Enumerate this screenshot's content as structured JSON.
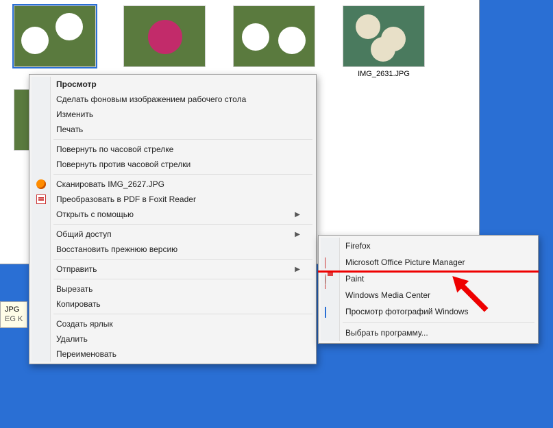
{
  "thumbs": {
    "t1": {
      "label": ""
    },
    "t2": {
      "label": ""
    },
    "t3": {
      "label": ""
    },
    "t4": {
      "label": "IMG_2631.JPG"
    }
  },
  "tooltip": {
    "line1": "JPG",
    "line2": "EG   K"
  },
  "context_menu": {
    "view": "Просмотр",
    "set_wallpaper": "Сделать фоновым изображением рабочего стола",
    "edit": "Изменить",
    "print": "Печать",
    "rotate_cw": "Повернуть по часовой стрелке",
    "rotate_ccw": "Повернуть против часовой стрелки",
    "scan": "Сканировать IMG_2627.JPG",
    "to_pdf": "Преобразовать в PDF в Foxit Reader",
    "open_with": "Открыть с помощью",
    "share": "Общий доступ",
    "restore": "Восстановить прежнюю версию",
    "send_to": "Отправить",
    "cut": "Вырезать",
    "copy": "Копировать",
    "shortcut": "Создать ярлык",
    "delete": "Удалить",
    "rename": "Переименовать"
  },
  "submenu": {
    "firefox": "Firefox",
    "mspic": "Microsoft Office Picture Manager",
    "paint": "Paint",
    "wmc": "Windows Media Center",
    "wpv": "Просмотр фотографий Windows",
    "choose": "Выбрать программу..."
  }
}
